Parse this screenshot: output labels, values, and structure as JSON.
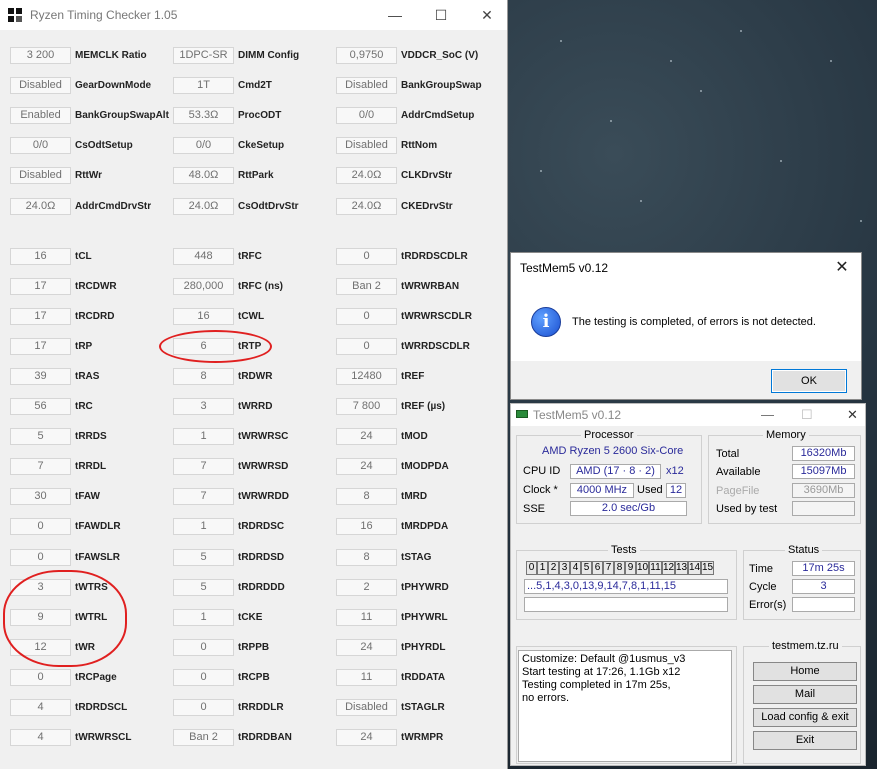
{
  "rtc": {
    "title": "Ryzen Timing Checker 1.05",
    "window_controls": {
      "minimize": "—",
      "maximize": "☐",
      "close": "✕"
    },
    "rows": [
      [
        {
          "value": "3 200",
          "label": "MEMCLK Ratio"
        },
        {
          "value": "1DPC-SR",
          "label": "DIMM Config"
        },
        {
          "value": "0,9750",
          "label": "VDDCR_SoC (V)"
        }
      ],
      [
        {
          "value": "Disabled",
          "label": "GearDownMode"
        },
        {
          "value": "1T",
          "label": "Cmd2T"
        },
        {
          "value": "Disabled",
          "label": "BankGroupSwap"
        }
      ],
      [
        {
          "value": "Enabled",
          "label": "BankGroupSwapAlt"
        },
        {
          "value": "53.3Ω",
          "label": "ProcODT"
        },
        {
          "value": "0/0",
          "label": "AddrCmdSetup"
        }
      ],
      [
        {
          "value": "0/0",
          "label": "CsOdtSetup"
        },
        {
          "value": "0/0",
          "label": "CkeSetup"
        },
        {
          "value": "Disabled",
          "label": "RttNom"
        }
      ],
      [
        {
          "value": "Disabled",
          "label": "RttWr"
        },
        {
          "value": "48.0Ω",
          "label": "RttPark"
        },
        {
          "value": "24.0Ω",
          "label": "CLKDrvStr"
        }
      ],
      [
        {
          "value": "24.0Ω",
          "label": "AddrCmdDrvStr"
        },
        {
          "value": "24.0Ω",
          "label": "CsOdtDrvStr"
        },
        {
          "value": "24.0Ω",
          "label": "CKEDrvStr"
        }
      ],
      [
        {
          "value": "16",
          "label": "tCL"
        },
        {
          "value": "448",
          "label": "tRFC"
        },
        {
          "value": "0",
          "label": "tRDRDSCDLR"
        }
      ],
      [
        {
          "value": "17",
          "label": "tRCDWR"
        },
        {
          "value": "280,000",
          "label": "tRFC (ns)"
        },
        {
          "value": "Ban 2",
          "label": "tWRWRBAN"
        }
      ],
      [
        {
          "value": "17",
          "label": "tRCDRD"
        },
        {
          "value": "16",
          "label": "tCWL"
        },
        {
          "value": "0",
          "label": "tWRWRSCDLR"
        }
      ],
      [
        {
          "value": "17",
          "label": "tRP"
        },
        {
          "value": "6",
          "label": "tRTP"
        },
        {
          "value": "0",
          "label": "tWRRDSCDLR"
        }
      ],
      [
        {
          "value": "39",
          "label": "tRAS"
        },
        {
          "value": "8",
          "label": "tRDWR"
        },
        {
          "value": "12480",
          "label": "tREF"
        }
      ],
      [
        {
          "value": "56",
          "label": "tRC"
        },
        {
          "value": "3",
          "label": "tWRRD"
        },
        {
          "value": "7 800",
          "label": "tREF (µs)"
        }
      ],
      [
        {
          "value": "5",
          "label": "tRRDS"
        },
        {
          "value": "1",
          "label": "tWRWRSC"
        },
        {
          "value": "24",
          "label": "tMOD"
        }
      ],
      [
        {
          "value": "7",
          "label": "tRRDL"
        },
        {
          "value": "7",
          "label": "tWRWRSD"
        },
        {
          "value": "24",
          "label": "tMODPDA"
        }
      ],
      [
        {
          "value": "30",
          "label": "tFAW"
        },
        {
          "value": "7",
          "label": "tWRWRDD"
        },
        {
          "value": "8",
          "label": "tMRD"
        }
      ],
      [
        {
          "value": "0",
          "label": "tFAWDLR"
        },
        {
          "value": "1",
          "label": "tRDRDSC"
        },
        {
          "value": "16",
          "label": "tMRDPDA"
        }
      ],
      [
        {
          "value": "0",
          "label": "tFAWSLR"
        },
        {
          "value": "5",
          "label": "tRDRDSD"
        },
        {
          "value": "8",
          "label": "tSTAG"
        }
      ],
      [
        {
          "value": "3",
          "label": "tWTRS"
        },
        {
          "value": "5",
          "label": "tRDRDDD"
        },
        {
          "value": "2",
          "label": "tPHYWRD"
        }
      ],
      [
        {
          "value": "9",
          "label": "tWTRL"
        },
        {
          "value": "1",
          "label": "tCKE"
        },
        {
          "value": "11",
          "label": "tPHYWRL"
        }
      ],
      [
        {
          "value": "12",
          "label": "tWR"
        },
        {
          "value": "0",
          "label": "tRPPB"
        },
        {
          "value": "24",
          "label": "tPHYRDL"
        }
      ],
      [
        {
          "value": "0",
          "label": "tRCPage"
        },
        {
          "value": "0",
          "label": "tRCPB"
        },
        {
          "value": "11",
          "label": "tRDDATA"
        }
      ],
      [
        {
          "value": "4",
          "label": "tRDRDSCL"
        },
        {
          "value": "0",
          "label": "tRRDDLR"
        },
        {
          "value": "Disabled",
          "label": "tSTAGLR"
        }
      ],
      [
        {
          "value": "4",
          "label": "tWRWRSCL"
        },
        {
          "value": "Ban 2",
          "label": "tRDRDBAN"
        },
        {
          "value": "24",
          "label": "tWRMPR"
        }
      ]
    ]
  },
  "dialog": {
    "title": "TestMem5 v0.12",
    "close": "✕",
    "icon": "info-icon",
    "message": "The testing is completed, of errors is not detected.",
    "ok_label": "OK"
  },
  "testmem": {
    "title": "TestMem5 v0.12",
    "window_controls": {
      "minimize": "—",
      "maximize": "☐",
      "close": "✕"
    },
    "processor": {
      "header": "Processor",
      "name": "AMD Ryzen 5 2600 Six-Core",
      "cpu_id_label": "CPU ID",
      "cpu_id": "AMD  (17 · 8 · 2)",
      "threads": "x12",
      "clock_label": "Clock *",
      "clock": "4000 MHz",
      "used_label": "Used",
      "used": "12",
      "sse_label": "SSE",
      "sse": "2.0 sec/Gb"
    },
    "memory": {
      "header": "Memory",
      "total_label": "Total",
      "total": "16320Mb",
      "available_label": "Available",
      "available": "15097Mb",
      "pagefile_label": "PageFile",
      "pagefile": "3690Mb",
      "used_by_test_label": "Used by test",
      "used_by_test": ""
    },
    "tests": {
      "header": "Tests",
      "numbers": [
        "0",
        "1",
        "2",
        "3",
        "4",
        "5",
        "6",
        "7",
        "8",
        "9",
        "10",
        "11",
        "12",
        "13",
        "14",
        "15"
      ],
      "sequence": "...5,1,4,3,0,13,9,14,7,8,1,11,15",
      "progress_text": ""
    },
    "status": {
      "header": "Status",
      "time_label": "Time",
      "time": "17m 25s",
      "cycle_label": "Cycle",
      "cycle": "3",
      "errors_label": "Error(s)",
      "errors": ""
    },
    "log": {
      "line1": "Customize: Default @1usmus_v3",
      "line2": "Start testing at 17:26, 1.1Gb x12",
      "line3": "Testing completed in 17m 25s,",
      "line4": "no errors."
    },
    "site": {
      "header": "testmem.tz.ru",
      "home_label": "Home",
      "mail_label": "Mail",
      "load_label": "Load config & exit",
      "exit_label": "Exit"
    }
  }
}
